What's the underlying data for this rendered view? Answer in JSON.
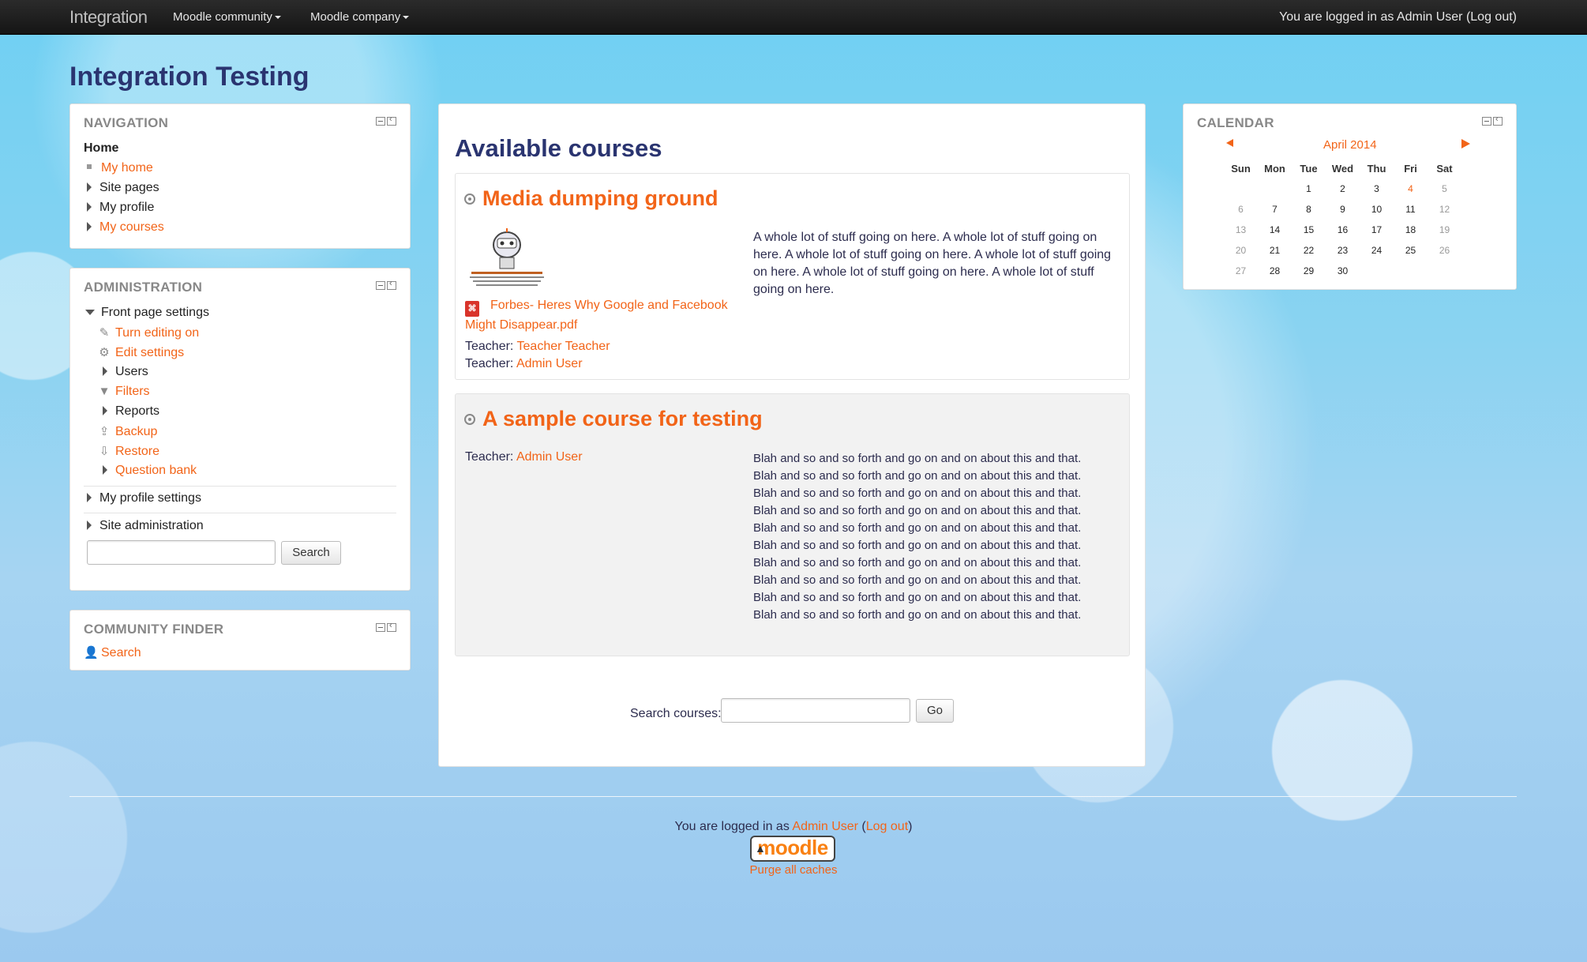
{
  "topbar": {
    "brand": "Integration",
    "menu": [
      "Moodle community",
      "Moodle company"
    ],
    "login_info": "You are logged in as Admin User (Log out)"
  },
  "page_title": "Integration Testing",
  "navigation": {
    "title": "NAVIGATION",
    "home": "Home",
    "items": [
      "My home",
      "Site pages",
      "My profile",
      "My courses"
    ]
  },
  "administration": {
    "title": "ADMINISTRATION",
    "front_page_settings": "Front page settings",
    "sub_items": [
      "Turn editing on",
      "Edit settings",
      "Users",
      "Filters",
      "Reports",
      "Backup",
      "Restore",
      "Question bank"
    ],
    "my_profile_settings": "My profile settings",
    "site_administration": "Site administration",
    "search_button": "Search"
  },
  "community_finder": {
    "title": "COMMUNITY FINDER",
    "search": "Search"
  },
  "main": {
    "heading": "Available courses",
    "courses": [
      {
        "title": "Media dumping ground",
        "file": "Forbes- Heres Why Google and Facebook Might Disappear.pdf",
        "teachers": [
          {
            "label": "Teacher:",
            "name": "Teacher Teacher"
          },
          {
            "label": "Teacher:",
            "name": "Admin User"
          }
        ],
        "summary": "A whole lot of stuff going on here. A whole lot of stuff going on here. A whole lot of stuff going on here. A whole lot of stuff going on here. A whole lot of stuff going on here. A whole lot of stuff going on here."
      },
      {
        "title": "A sample course for testing",
        "teachers": [
          {
            "label": "Teacher:",
            "name": "Admin User"
          }
        ],
        "summary": "Blah and so and so forth and go on and on about this and that. Blah and so and so forth and go on and on about this and that. Blah and so and so forth and go on and on about this and that. Blah and so and so forth and go on and on about this and that. Blah and so and so forth and go on and on about this and that. Blah and so and so forth and go on and on about this and that. Blah and so and so forth and go on and on about this and that. Blah and so and so forth and go on and on about this and that. Blah and so and so forth and go on and on about this and that. Blah and so and so forth and go on and on about this and that."
      }
    ],
    "search_label": "Search courses:",
    "go_button": "Go"
  },
  "calendar": {
    "title": "CALENDAR",
    "month": "April 2014",
    "days": [
      "Sun",
      "Mon",
      "Tue",
      "Wed",
      "Thu",
      "Fri",
      "Sat"
    ],
    "weeks": [
      [
        "",
        "",
        "1",
        "2",
        "3",
        "4",
        "5"
      ],
      [
        "6",
        "7",
        "8",
        "9",
        "10",
        "11",
        "12"
      ],
      [
        "13",
        "14",
        "15",
        "16",
        "17",
        "18",
        "19"
      ],
      [
        "20",
        "21",
        "22",
        "23",
        "24",
        "25",
        "26"
      ],
      [
        "27",
        "28",
        "29",
        "30",
        "",
        "",
        ""
      ]
    ],
    "today": "4"
  },
  "footer": {
    "logged_prefix": "You are logged in as",
    "user": "Admin User",
    "logout": "Log out",
    "logo": "moodle",
    "purge": "Purge all caches"
  },
  "colors": {
    "accent": "#f26418",
    "heading": "#2a3470",
    "topbar": "#1b1b1b"
  }
}
